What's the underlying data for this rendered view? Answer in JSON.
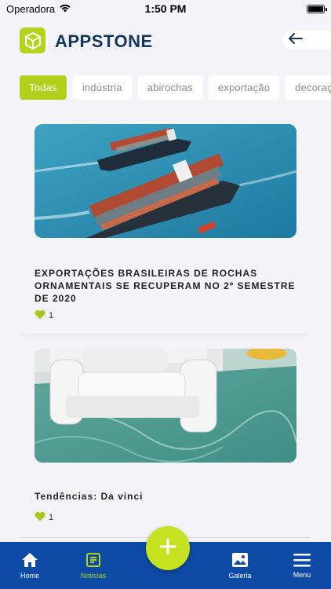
{
  "status_bar": {
    "carrier": "Operadora",
    "time": "1:50 PM"
  },
  "header": {
    "app_name": "APPSTONE",
    "back_icon": "arrow-left-icon"
  },
  "categories": [
    {
      "label": "Todas",
      "active": true
    },
    {
      "label": "indústria",
      "active": false
    },
    {
      "label": "abirochas",
      "active": false
    },
    {
      "label": "exportação",
      "active": false
    },
    {
      "label": "decoraç",
      "active": false
    }
  ],
  "feed": [
    {
      "title": "EXPORTAÇÕES BRASILEIRAS DE ROCHAS ORNAMENTAIS SE RECUPERAM NO 2º SEMESTRE DE 2020",
      "image": "cargo-ships-photo",
      "likes": "1"
    },
    {
      "title": "Tendências: Da vinci",
      "image": "white-armchair-marble-floor-photo",
      "likes": "1"
    }
  ],
  "bottom_nav": {
    "home": "Home",
    "news": "Notícias",
    "gallery": "Galeria",
    "menu": "Menu"
  },
  "colors": {
    "accent": "#b2cf1a",
    "nav_bg": "#0d4aa5",
    "brand_text": "#13365f"
  }
}
